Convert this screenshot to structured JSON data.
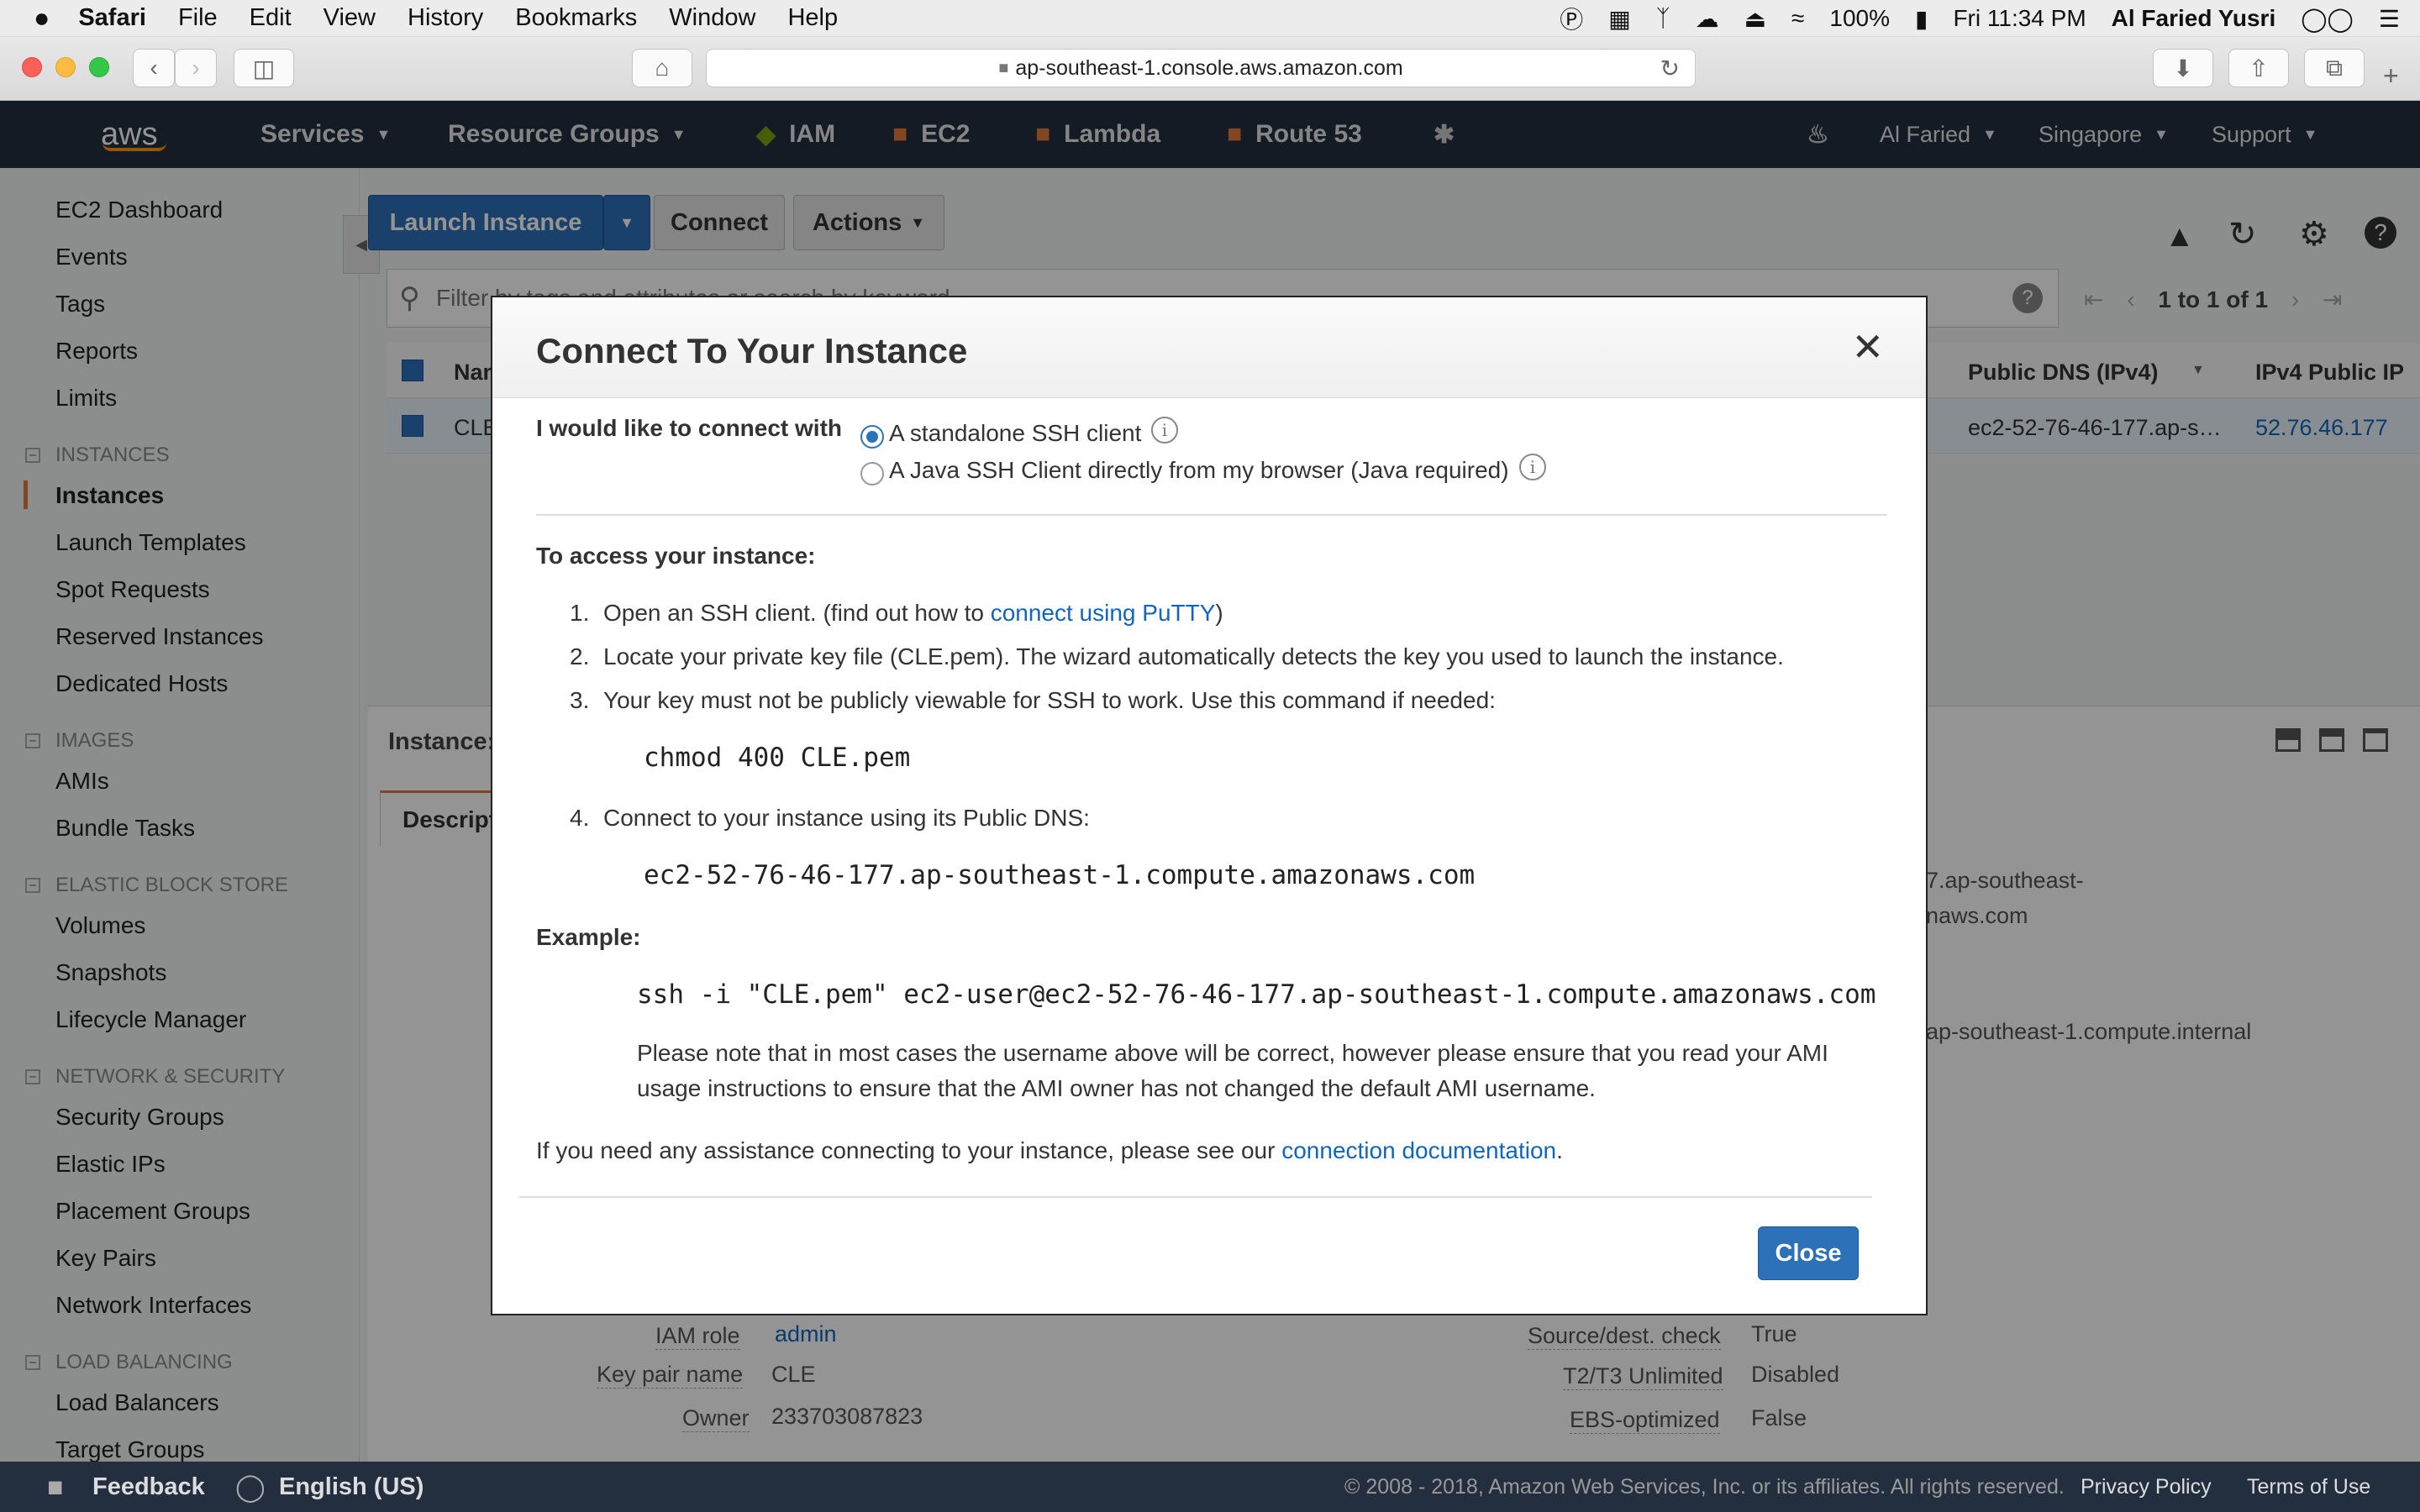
{
  "mac_menu": {
    "app": "Safari",
    "items": [
      "File",
      "Edit",
      "View",
      "History",
      "Bookmarks",
      "Window",
      "Help"
    ],
    "battery": "100%",
    "clock": "Fri 11:34 PM",
    "user": "Al Faried Yusri"
  },
  "browser": {
    "url": "ap-southeast-1.console.aws.amazon.com"
  },
  "aws_nav": {
    "logo": "aws",
    "services": "Services",
    "resource_groups": "Resource Groups",
    "shortcuts": [
      "IAM",
      "EC2",
      "Lambda",
      "Route 53"
    ],
    "account": "Al Faried",
    "region": "Singapore",
    "support": "Support"
  },
  "sidebar": {
    "top": [
      "EC2 Dashboard",
      "Events",
      "Tags",
      "Reports",
      "Limits"
    ],
    "instances_header": "INSTANCES",
    "instances": [
      "Instances",
      "Launch Templates",
      "Spot Requests",
      "Reserved Instances",
      "Dedicated Hosts"
    ],
    "images_header": "IMAGES",
    "images": [
      "AMIs",
      "Bundle Tasks"
    ],
    "ebs_header": "ELASTIC BLOCK STORE",
    "ebs": [
      "Volumes",
      "Snapshots",
      "Lifecycle Manager"
    ],
    "net_header": "NETWORK & SECURITY",
    "net": [
      "Security Groups",
      "Elastic IPs",
      "Placement Groups",
      "Key Pairs",
      "Network Interfaces"
    ],
    "lb_header": "LOAD BALANCING",
    "lb": [
      "Load Balancers",
      "Target Groups"
    ]
  },
  "actions_bar": {
    "launch": "Launch Instance",
    "connect": "Connect",
    "actions": "Actions"
  },
  "table": {
    "filter_placeholder": "Filter by tags and attributes or search by keyword",
    "pagination": "1 to 1 of 1",
    "col_name": "Name",
    "col_dns": "Public DNS (IPv4)",
    "col_ip": "IPv4 Public IP",
    "row_name": "CLE",
    "row_dns": "ec2-52-76-46-177.ap-s…",
    "row_ip": "52.76.46.177"
  },
  "details": {
    "instance_label": "Instance:",
    "tab": "Description",
    "dns_frag1": "7.ap-southeast-",
    "dns_frag2": "naws.com",
    "private_frag": "ap-southeast-1.compute.internal",
    "iam_label": "IAM role",
    "iam_value": "admin",
    "key_label": "Key pair name",
    "key_value": "CLE",
    "owner_label": "Owner",
    "owner_value": "233703087823",
    "srcdest_label": "Source/dest. check",
    "srcdest_value": "True",
    "t2_label": "T2/T3 Unlimited",
    "t2_value": "Disabled",
    "ebs_label": "EBS-optimized",
    "ebs_value": "False"
  },
  "modal": {
    "title": "Connect To Your Instance",
    "connect_with": "I would like to connect with",
    "option1": "A standalone SSH client",
    "option2": "A Java SSH Client directly from my browser (Java required)",
    "access_heading": "To access your instance:",
    "step1_num": "1.",
    "step1_a": "Open an SSH client. (find out how to",
    "step1_link": "connect using PuTTY",
    "step1_b": ")",
    "step2_num": "2.",
    "step2": "Locate your private key file (CLE.pem). The wizard automatically detects the key you used to launch the instance.",
    "step3_num": "3.",
    "step3": "Your key must not be publicly viewable for SSH to work. Use this command if needed:",
    "chmod_cmd": "chmod 400 CLE.pem",
    "step4_num": "4.",
    "step4": "Connect to your instance using its Public DNS:",
    "public_dns": "ec2-52-76-46-177.ap-southeast-1.compute.amazonaws.com",
    "example_label": "Example:",
    "ssh_cmd": "ssh -i \"CLE.pem\" ec2-user@ec2-52-76-46-177.ap-southeast-1.compute.amazonaws.com",
    "note_line1": "Please note that in most cases the username above will be correct, however please ensure that you read your AMI",
    "note_line2": "usage instructions to ensure that the AMI owner has not changed the default AMI username.",
    "help_a": "If you need any assistance connecting to your instance, please see our",
    "help_link": "connection documentation",
    "help_b": ".",
    "close": "Close"
  },
  "footer": {
    "feedback": "Feedback",
    "language": "English (US)",
    "copyright": "© 2008 - 2018, Amazon Web Services, Inc. or its affiliates. All rights reserved.",
    "privacy": "Privacy Policy",
    "terms": "Terms of Use"
  },
  "colors": {
    "aws_nav": "#232f3e",
    "primary_button": "#2d71b8",
    "link": "#1166bb"
  }
}
